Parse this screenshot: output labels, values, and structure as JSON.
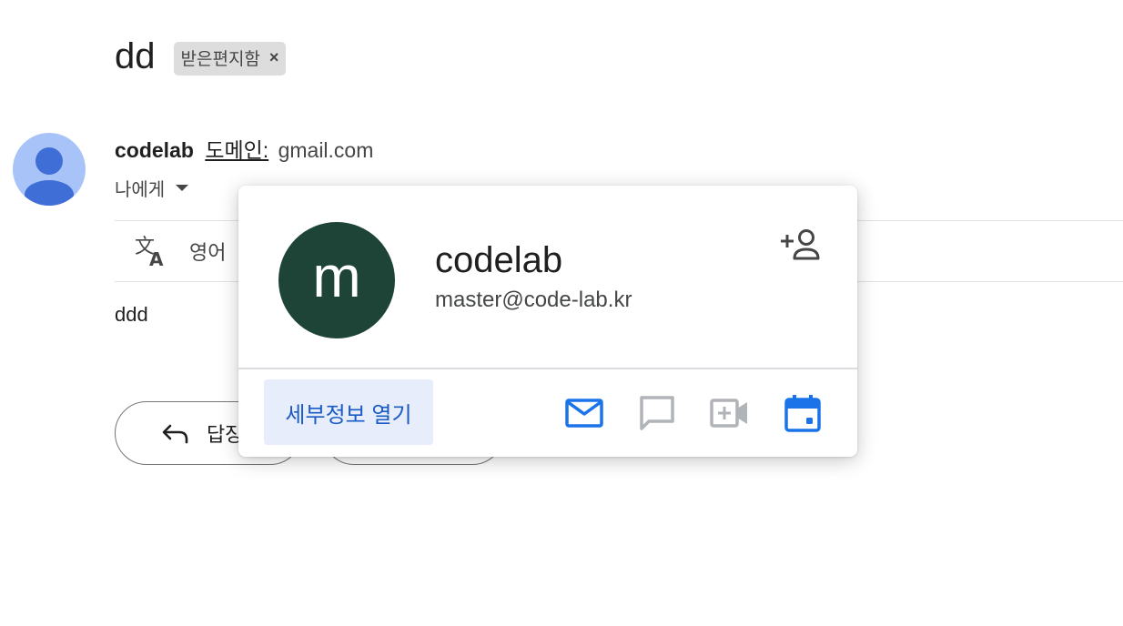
{
  "subject": {
    "title": "dd",
    "label": "받은편지함",
    "remove_label": "×"
  },
  "sender": {
    "name": "codelab",
    "domain_label": "도메인:",
    "domain": "gmail.com",
    "to": "나에게"
  },
  "translate": {
    "language": "영어"
  },
  "body": {
    "text": "ddd"
  },
  "actions": {
    "reply": "답장",
    "forward": ""
  },
  "card": {
    "initial": "m",
    "name": "codelab",
    "email": "master@code-lab.kr",
    "details_button": "세부정보 열기",
    "icons": [
      "add-contact-icon",
      "mail-icon",
      "chat-icon",
      "video-call-icon",
      "calendar-icon"
    ],
    "colors": {
      "avatar": "#1d4437",
      "accent": "#1a73e8",
      "disabled": "#b0b3b8"
    }
  }
}
